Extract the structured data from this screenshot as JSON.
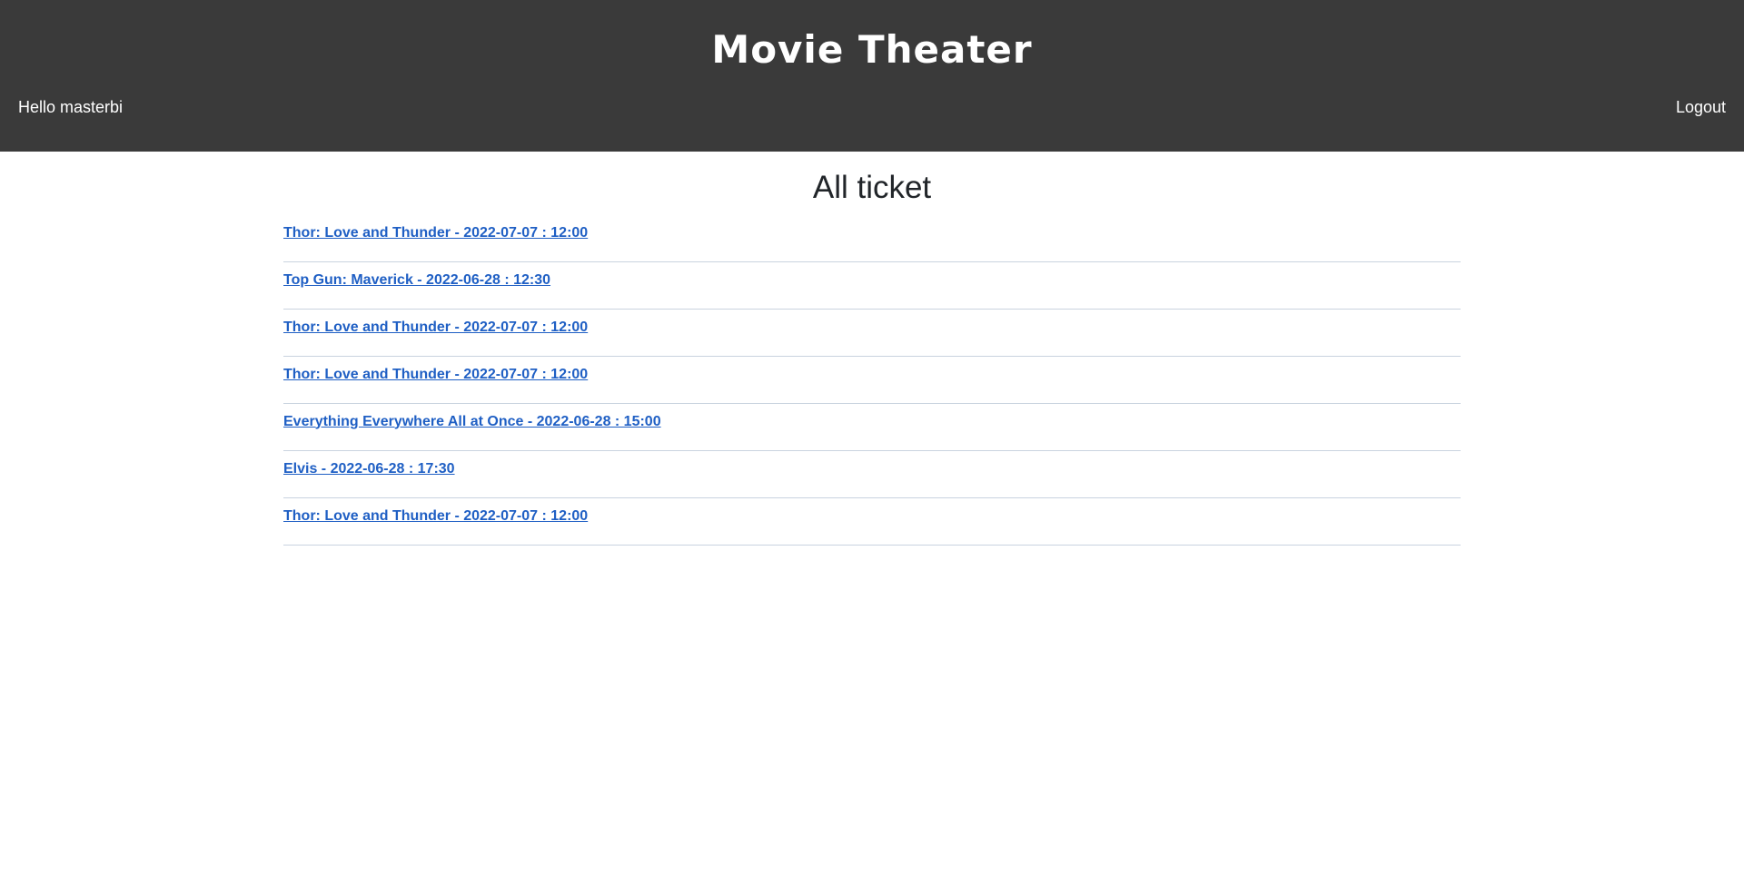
{
  "header": {
    "brand": "Movie Theater",
    "greeting": "Hello masterbi",
    "logout_label": "Logout"
  },
  "main": {
    "title": "All ticket",
    "tickets": [
      {
        "label": "Thor: Love and Thunder - 2022-07-07 : 12:00"
      },
      {
        "label": "Top Gun: Maverick - 2022-06-28 : 12:30"
      },
      {
        "label": "Thor: Love and Thunder - 2022-07-07 : 12:00"
      },
      {
        "label": "Thor: Love and Thunder - 2022-07-07 : 12:00"
      },
      {
        "label": "Everything Everywhere All at Once - 2022-06-28 : 15:00"
      },
      {
        "label": "Elvis - 2022-06-28 : 17:30"
      },
      {
        "label": "Thor: Love and Thunder - 2022-07-07 : 12:00"
      }
    ]
  },
  "colors": {
    "header_bg": "#3a3a3a",
    "link": "#1f5fc4",
    "divider": "#c9d3df"
  }
}
